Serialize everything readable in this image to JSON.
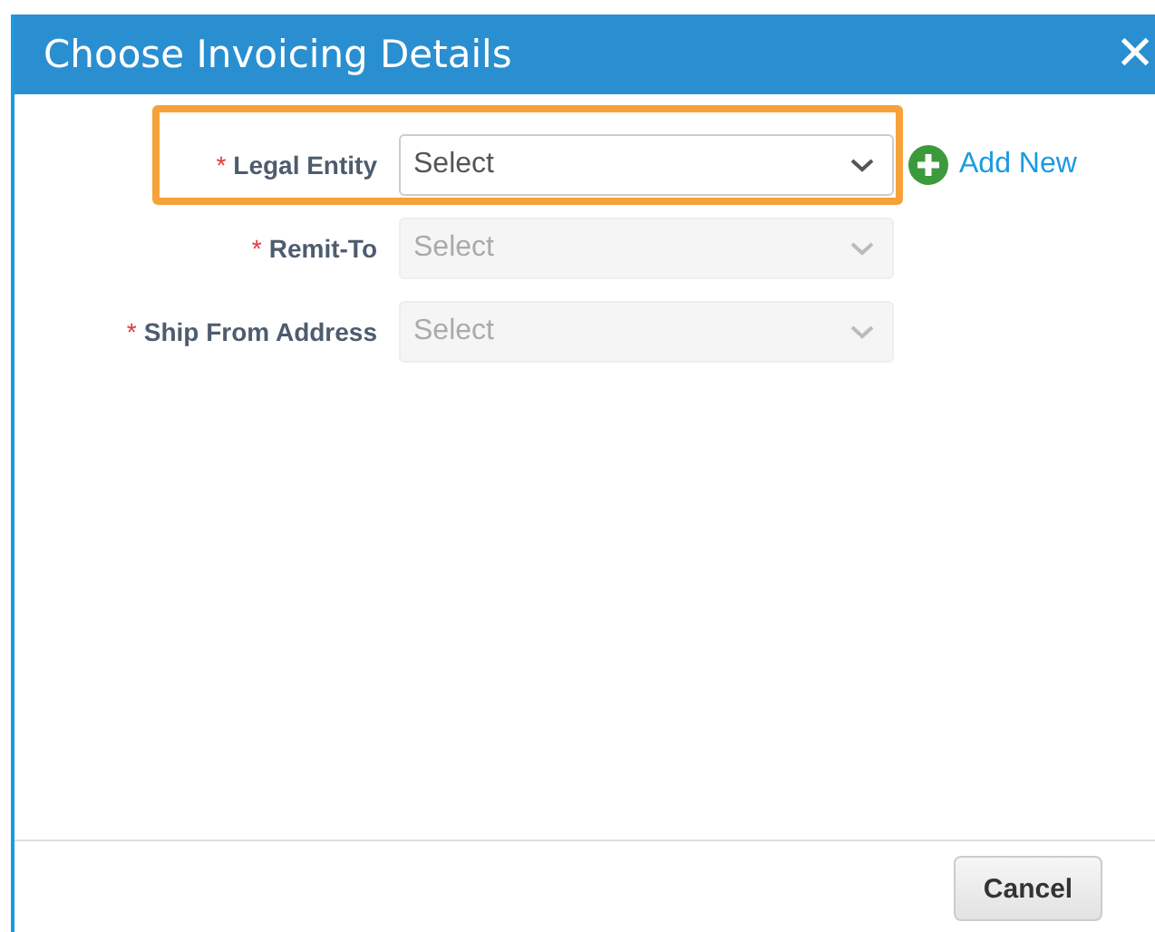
{
  "dialog": {
    "title": "Choose Invoicing Details",
    "close_label": "✕"
  },
  "fields": [
    {
      "label": "Legal Entity",
      "required": true,
      "required_mark": "*",
      "placeholder": "Select",
      "disabled": false,
      "highlighted": true,
      "action": "Add New"
    },
    {
      "label": "Remit-To",
      "required": true,
      "required_mark": "*",
      "placeholder": "Select",
      "disabled": true,
      "highlighted": false
    },
    {
      "label": "Ship From Address",
      "required": true,
      "required_mark": "*",
      "placeholder": "Select",
      "disabled": true,
      "highlighted": false
    }
  ],
  "buttons": [
    "Cancel"
  ]
}
